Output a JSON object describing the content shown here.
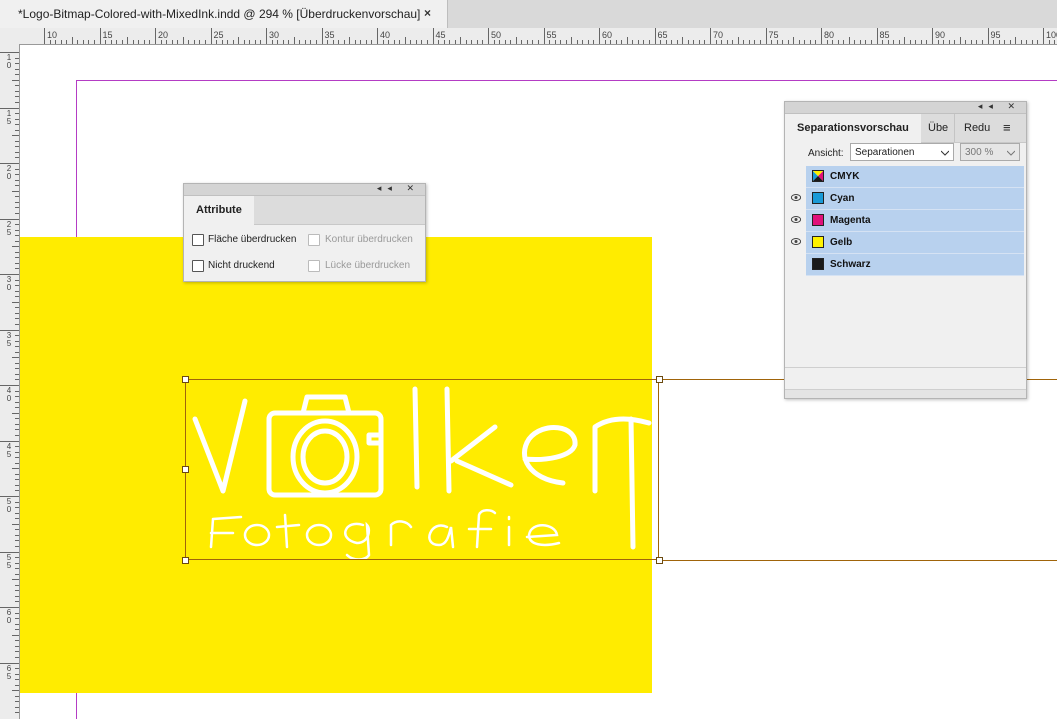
{
  "document_tab": {
    "title": "*Logo-Bitmap-Colored-with-MixedInk.indd @ 294 % [Überdruckenvorschau]",
    "close_glyph": "×"
  },
  "ruler": {
    "horizontal_labels": [
      "10",
      "15",
      "20",
      "25",
      "30",
      "35",
      "40",
      "45",
      "50",
      "55",
      "60",
      "65",
      "70",
      "75",
      "80",
      "85",
      "90",
      "95",
      "100"
    ],
    "vertical_labels": [
      "10",
      "15",
      "20",
      "25",
      "30",
      "35",
      "40",
      "45",
      "50",
      "55",
      "60",
      "65"
    ]
  },
  "attribute_panel": {
    "tab_label": "Attribute",
    "collapse_glyph": "◂◂",
    "close_glyph": "✕",
    "options": {
      "fill_overprint": {
        "label": "Fläche überdrucken",
        "checked": false,
        "enabled": true
      },
      "stroke_overprint": {
        "label": "Kontur überdrucken",
        "checked": false,
        "enabled": false
      },
      "nonprinting": {
        "label": "Nicht druckend",
        "checked": false,
        "enabled": true
      },
      "gap_overprint": {
        "label": "Lücke überdrucken",
        "checked": false,
        "enabled": false
      }
    }
  },
  "separations_panel": {
    "tabs": [
      {
        "label": "Separationsvorschau",
        "active": true
      },
      {
        "label": "Übe",
        "active": false
      },
      {
        "label": "Redu",
        "active": false
      }
    ],
    "menu_icon": "≡",
    "collapse_glyph": "◂◂",
    "close_glyph": "✕",
    "view_label": "Ansicht:",
    "view_value": "Separationen",
    "zoom_value": "300 %",
    "rows": [
      {
        "name": "CMYK",
        "color": "cmyk",
        "visible": false
      },
      {
        "name": "Cyan",
        "color": "#1a9ad6",
        "visible": true
      },
      {
        "name": "Magenta",
        "color": "#e0107a",
        "visible": true
      },
      {
        "name": "Gelb",
        "color": "#fff200",
        "visible": true
      },
      {
        "name": "Schwarz",
        "color": "#1a1a1a",
        "visible": false
      }
    ]
  },
  "artwork": {
    "logo_main": "volker",
    "logo_sub": "Fotografie",
    "background_color": "#ffec00",
    "logo_color": "#ffffff"
  },
  "colors": {
    "guide": "#b43cc4",
    "frame": "#a0640a",
    "selection_row": "#b8d1ee"
  }
}
